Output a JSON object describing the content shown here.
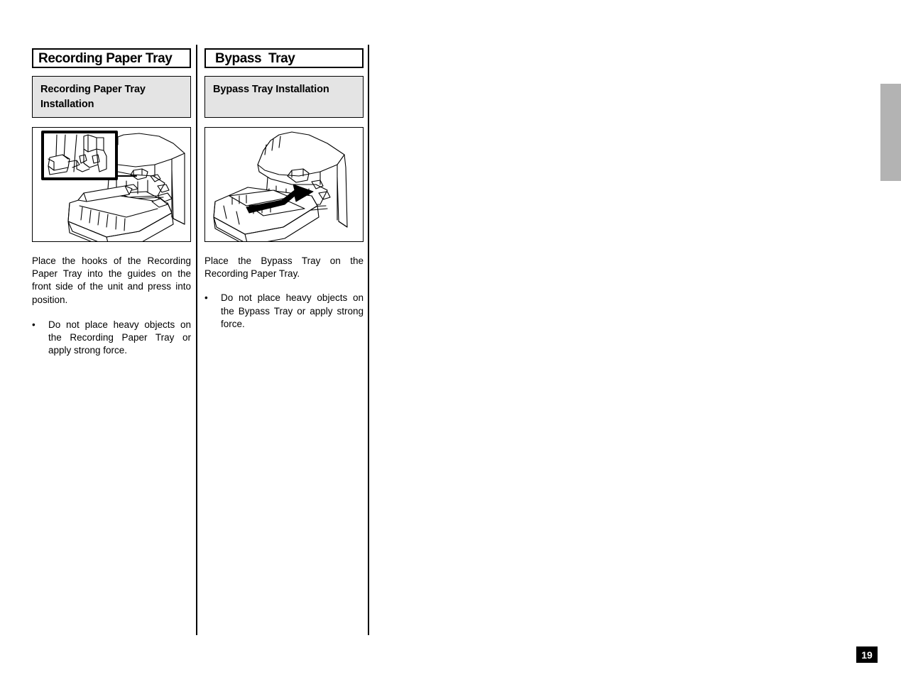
{
  "page": {
    "number": "19",
    "thumb_tab_color": "#b3b3b3",
    "subhead_background": "#e4e4e4"
  },
  "columns": [
    {
      "title": "Recording Paper Tray",
      "subheading": "Recording Paper Tray\nInstallation",
      "figure_name": "recording-paper-tray-installation-illustration",
      "body": "Place the hooks of the Recording Paper Tray into the guides on the front side of the unit and press into position.",
      "bullet_mark": "•",
      "bullet": "Do not place heavy objects on the Recording Paper Tray or apply strong force."
    },
    {
      "title": "Bypass  Tray",
      "subheading": "Bypass Tray Installation",
      "figure_name": "bypass-tray-installation-illustration",
      "body": "Place the Bypass Tray on the Recording Paper Tray.",
      "bullet_mark": "•",
      "bullet": "Do not place heavy objects on the Bypass Tray or apply strong force."
    }
  ]
}
